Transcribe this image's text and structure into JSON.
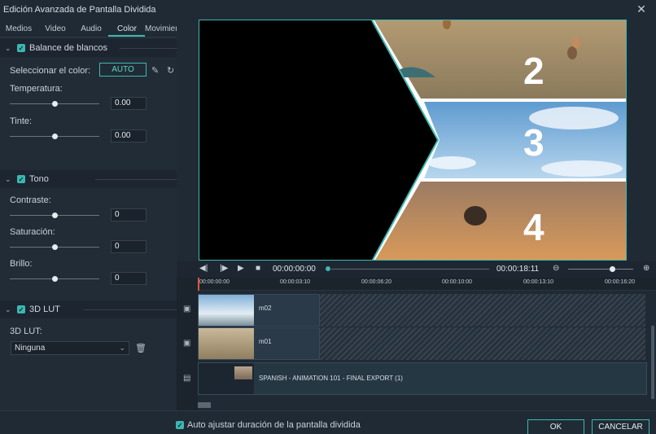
{
  "window": {
    "title": "Edición Avanzada de Pantalla Dividida"
  },
  "tabs": [
    "Medios",
    "Video",
    "Audio",
    "Color",
    "Movimient"
  ],
  "active_tab": "Color",
  "white_balance": {
    "title": "Balance de blancos",
    "select_color_label": "Seleccionar el color:",
    "auto_label": "AUTO",
    "temperature_label": "Temperatura:",
    "temperature_value": "0.00",
    "tint_label": "Tinte:",
    "tint_value": "0.00"
  },
  "tone": {
    "title": "Tono",
    "contrast_label": "Contraste:",
    "contrast_value": "0",
    "saturation_label": "Saturación:",
    "saturation_value": "0",
    "brightness_label": "Brillo:",
    "brightness_value": "0"
  },
  "lut": {
    "title": "3D LUT",
    "label": "3D LUT:",
    "selected": "Ninguna"
  },
  "preview": {
    "numbers": [
      "2",
      "3",
      "4"
    ]
  },
  "transport": {
    "current_time": "00:00:00:00",
    "total_time": "00:00:18:11",
    "progress": 0.0
  },
  "ruler": [
    "00:00:00:00",
    "00:00:03:10",
    "00:00:06:20",
    "00:00:10:00",
    "00:00:13:10",
    "00:00:16:20"
  ],
  "tracks": [
    {
      "name": "m02"
    },
    {
      "name": "m01"
    },
    {
      "name": "SPANISH - ANIMATION 101 - FINAL EXPORT (1)"
    }
  ],
  "footer": {
    "auto_adjust_label": "Auto ajustar duración de la pantalla dividida",
    "ok_label": "OK",
    "cancel_label": "CANCELAR"
  },
  "colors": {
    "accent": "#3fb7b0",
    "panel": "#222c37",
    "background": "#1f2a35"
  },
  "icons": [
    "close-icon",
    "chevron-down-icon",
    "eyedropper-icon",
    "reset-icon",
    "trash-icon",
    "zoom-out-icon",
    "zoom-in-icon",
    "image-icon",
    "film-icon"
  ]
}
